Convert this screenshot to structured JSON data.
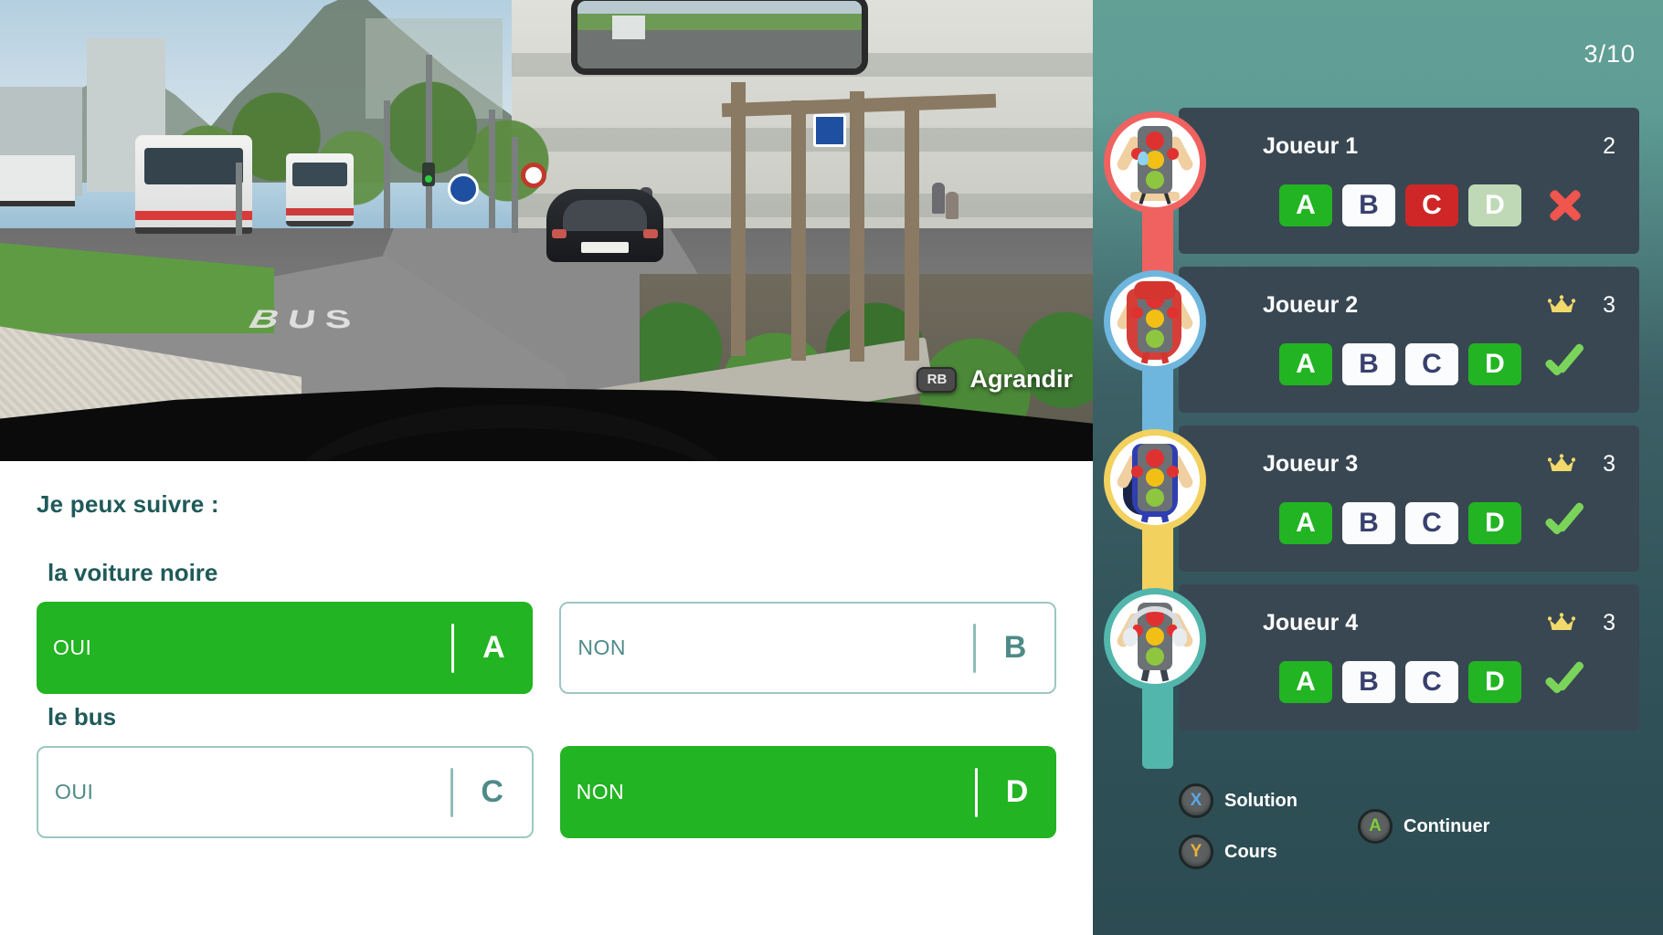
{
  "scene": {
    "zoom_hint_label": "Agrandir",
    "zoom_hint_button": "RB",
    "road_marking": "BUS"
  },
  "question": {
    "prompt": "Je peux suivre :",
    "group_1_label": "la voiture noire",
    "group_2_label": "le bus",
    "answers": [
      {
        "letter": "A",
        "text": "OUI",
        "state": "selected"
      },
      {
        "letter": "B",
        "text": "NON",
        "state": "plain"
      },
      {
        "letter": "C",
        "text": "OUI",
        "state": "plain"
      },
      {
        "letter": "D",
        "text": "NON",
        "state": "selected"
      }
    ]
  },
  "hud": {
    "progress": "3/10",
    "players": [
      {
        "name": "Joueur 1",
        "score": "2",
        "crown": false,
        "ring_color": "#f0625f",
        "result": "cross",
        "avatar": "traffic-light-crying",
        "answers": [
          {
            "letter": "A",
            "state": "green"
          },
          {
            "letter": "B",
            "state": "white"
          },
          {
            "letter": "C",
            "state": "red"
          },
          {
            "letter": "D",
            "state": "pale"
          }
        ]
      },
      {
        "name": "Joueur 2",
        "score": "3",
        "crown": true,
        "ring_color": "#6eb6dd",
        "result": "check",
        "avatar": "traffic-light-hero-red-cape",
        "answers": [
          {
            "letter": "A",
            "state": "green"
          },
          {
            "letter": "B",
            "state": "white"
          },
          {
            "letter": "C",
            "state": "white"
          },
          {
            "letter": "D",
            "state": "green"
          }
        ]
      },
      {
        "name": "Joueur 3",
        "score": "3",
        "crown": true,
        "ring_color": "#f2d15e",
        "result": "check",
        "avatar": "traffic-light-blue-suit",
        "answers": [
          {
            "letter": "A",
            "state": "green"
          },
          {
            "letter": "B",
            "state": "white"
          },
          {
            "letter": "C",
            "state": "white"
          },
          {
            "letter": "D",
            "state": "green"
          }
        ]
      },
      {
        "name": "Joueur 4",
        "score": "3",
        "crown": true,
        "ring_color": "#52b6ac",
        "result": "check",
        "avatar": "traffic-light-headphones",
        "answers": [
          {
            "letter": "A",
            "state": "green"
          },
          {
            "letter": "B",
            "state": "white"
          },
          {
            "letter": "C",
            "state": "white"
          },
          {
            "letter": "D",
            "state": "green"
          }
        ]
      }
    ],
    "controls": [
      {
        "button": "X",
        "label": "Solution"
      },
      {
        "button": "Y",
        "label": "Cours"
      },
      {
        "button": "A",
        "label": "Continuer"
      }
    ]
  },
  "colors": {
    "green": "#22b422",
    "red": "#cf2727",
    "teal": "#1f5a59",
    "panel": "#394752",
    "crown": "#f2d96b"
  }
}
